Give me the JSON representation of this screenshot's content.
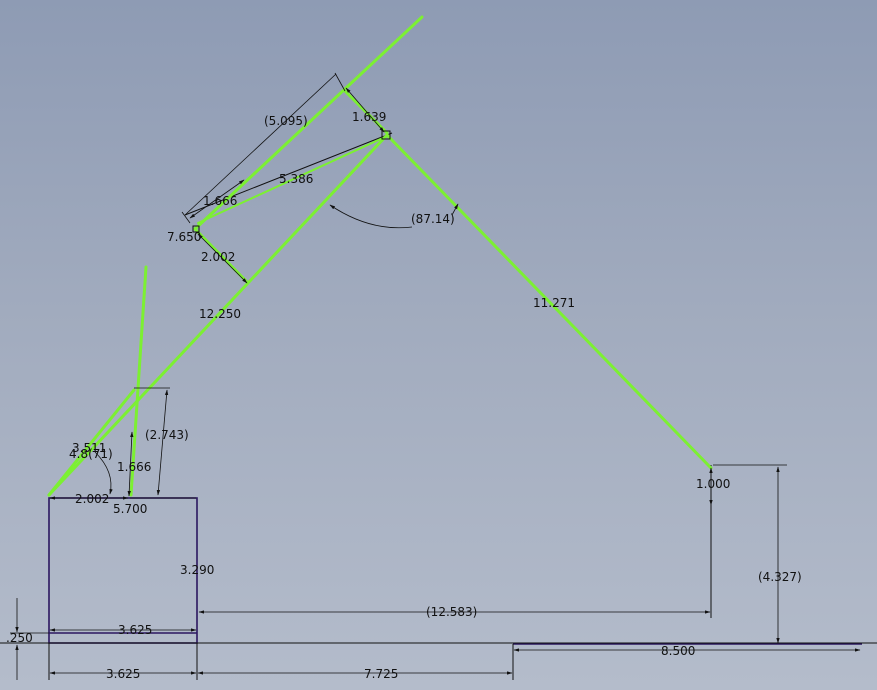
{
  "colors": {
    "background_top": "#8e9bb4",
    "background_bottom": "#b4bccb",
    "sketch_highlight": "#7cf032",
    "profile": "#2b1660",
    "dimension": "#111111"
  },
  "dimensions": {
    "d_5095": "(5.095)",
    "d_1639": "1.639",
    "d_1666_top": "1.666",
    "d_5386": "5.386",
    "d_8714": "(87.14)",
    "d_7650": "7.650",
    "d_2002_mid": "2.002",
    "d_12250": "12.250",
    "d_11271": "11.271",
    "d_2743": "(2.743)",
    "d_3511": "3.511",
    "d_4871": "4.8(71)",
    "d_1666_low": "1.666",
    "d_2002_low": "2.002",
    "d_5700": "5.700",
    "d_1000": "1.000",
    "d_3290": "3.290",
    "d_4327": "(4.327)",
    "d_12583": "(12.583)",
    "d_3625_upper": "3.625",
    "d_0250": ".250",
    "d_8500": "8.500",
    "d_3625_lower": "3.625",
    "d_7725": "7.725"
  }
}
